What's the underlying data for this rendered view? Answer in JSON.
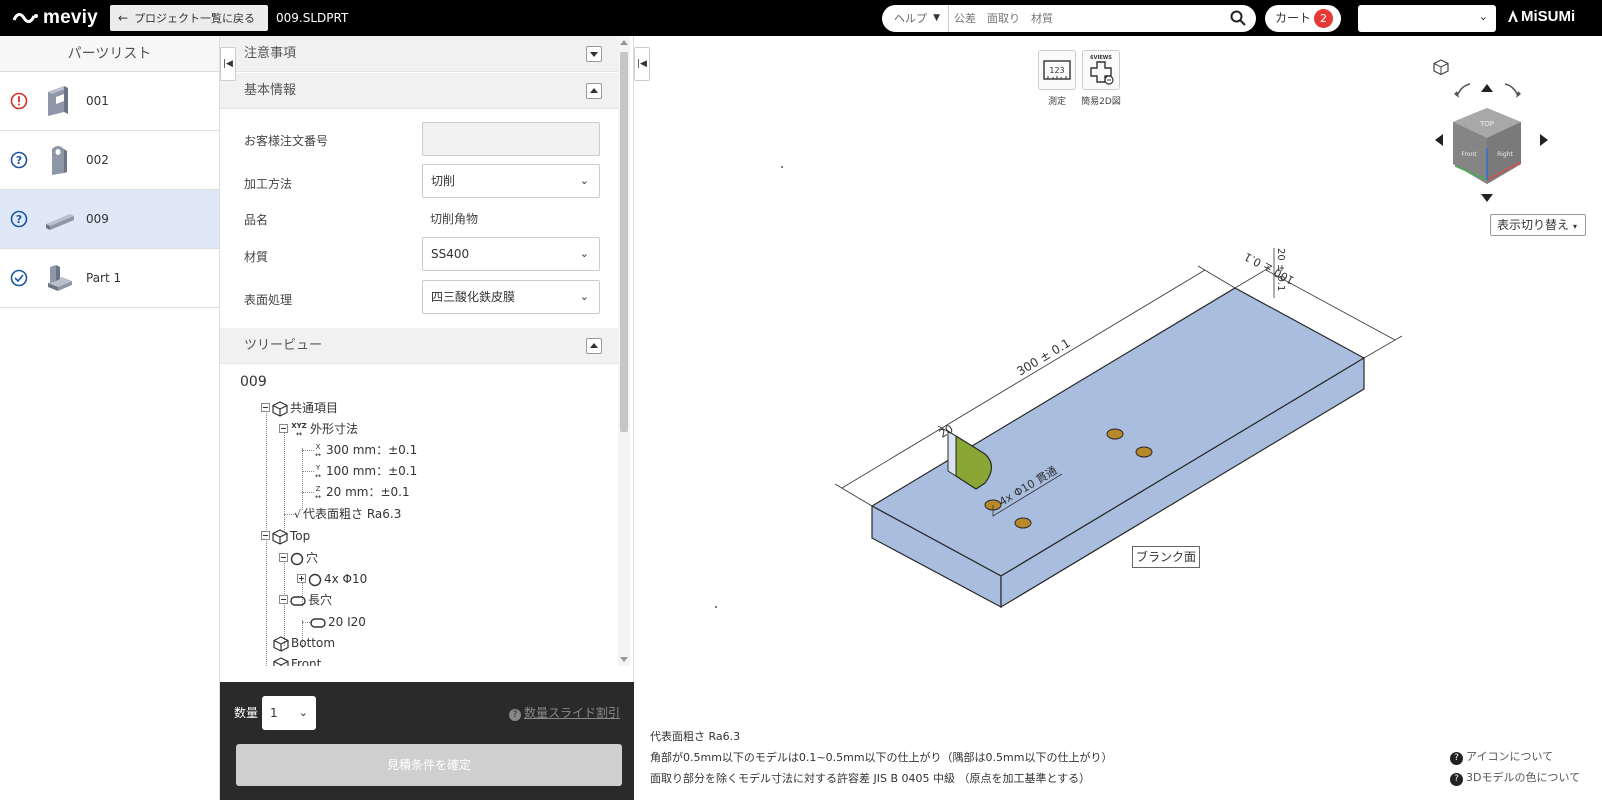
{
  "header": {
    "logo": "meviy",
    "back_label": "プロジェクト一覧に戻る",
    "file_name": "009.SLDPRT",
    "help_select": "ヘルプ",
    "search_placeholder": "公差　面取り　材質",
    "cart_label": "カート",
    "cart_count": "2",
    "brand": "MiSUMi"
  },
  "parts_list": {
    "title": "パーツリスト",
    "items": [
      {
        "name": "001",
        "status": "error"
      },
      {
        "name": "002",
        "status": "question"
      },
      {
        "name": "009",
        "status": "question",
        "selected": true
      },
      {
        "name": "Part 1",
        "status": "ok"
      }
    ]
  },
  "sections": {
    "notes": "注意事項",
    "basic_info": "基本情報",
    "tree_view": "ツリービュー"
  },
  "form": {
    "order_no_label": "お客様注文番号",
    "order_no_value": "",
    "method_label": "加工方法",
    "method_value": "切削",
    "product_label": "品名",
    "product_value": "切削角物",
    "material_label": "材質",
    "material_value": "SS400",
    "surface_label": "表面処理",
    "surface_value": "四三酸化鉄皮膜"
  },
  "tree": {
    "root": "009",
    "common": "共通項目",
    "outer_dims": "外形寸法",
    "x_dim": "300 mm：±0.1",
    "y_dim": "100 mm：±0.1",
    "z_dim": "20 mm：±0.1",
    "roughness": "代表面粗さ Ra6.3",
    "top": "Top",
    "hole": "穴",
    "hole_item": "4x Φ10",
    "slot": "長穴",
    "slot_item": "20 I20",
    "bottom": "Bottom",
    "front": "Front",
    "x_axis": "X",
    "y_axis": "Y",
    "z_axis": "Z",
    "xyz": "XYZ"
  },
  "order": {
    "qty_label": "数量",
    "qty_value": "1",
    "slide_discount": "数量スライド割引",
    "confirm": "見積条件を確定"
  },
  "viewer": {
    "measure_label": "測定",
    "measure_icon_text": "123",
    "simple2d_label": "簡易2D図",
    "simple2d_icon_text": "6VIEWS",
    "view_switch": "表示切り替え",
    "dim_length": "300 ± 0.1",
    "dim_width": "100 ± 0.1",
    "dim_height": "20 ± 0.1",
    "dim_slot": "20",
    "hole_note": "4x Φ10 貫通",
    "blank_face": "ブランク面",
    "cube_top": "TOP",
    "cube_left": "Front",
    "cube_right": "Right",
    "footer": [
      "代表面粗さ Ra6.3",
      "角部が0.5mm以下のモデルは0.1~0.5mm以下の仕上がり（隅部は0.5mm以下の仕上がり）",
      "面取り部分を除くモデル寸法に対する許容差 JIS B 0405 中級 （原点を加工基準とする）"
    ],
    "icon_help": "アイコンについて",
    "color_help": "3Dモデルの色について"
  },
  "colors": {
    "part_face": "#a9bddf",
    "slot_face": "#8aa635",
    "hole": "#b8892a",
    "selected_row": "#dfe8f7"
  }
}
